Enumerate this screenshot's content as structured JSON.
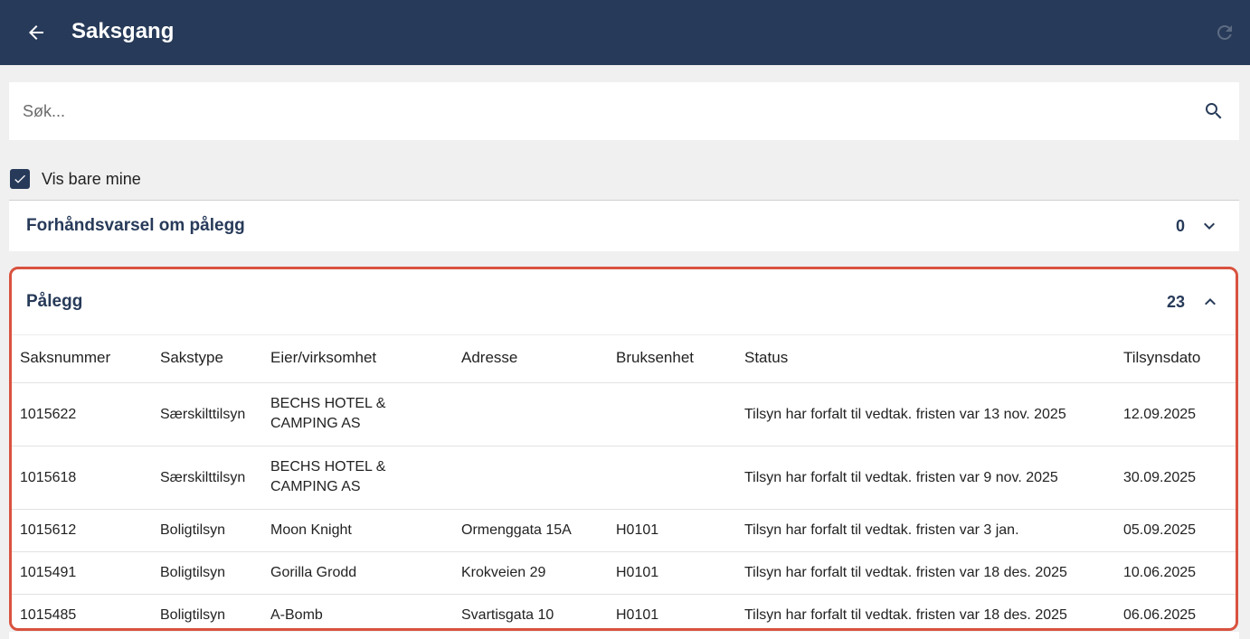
{
  "header": {
    "title": "Saksgang",
    "back_icon": "arrow-left-icon",
    "refresh_icon": "refresh-icon"
  },
  "search": {
    "placeholder": "Søk...",
    "value": "",
    "icon": "search-icon"
  },
  "filter": {
    "label": "Vis bare mine",
    "checked": true
  },
  "sections": [
    {
      "title": "Forhåndsvarsel om pålegg",
      "count": "0",
      "expanded": false
    },
    {
      "title": "Pålegg",
      "count": "23",
      "expanded": true,
      "columns": [
        "Saksnummer",
        "Sakstype",
        "Eier/virksomhet",
        "Adresse",
        "Bruksenhet",
        "Status",
        "Tilsynsdato"
      ],
      "rows": [
        {
          "saksnummer": "1015622",
          "sakstype": "Særskilttilsyn",
          "eier": "BECHS HOTEL & CAMPING AS",
          "adresse": "",
          "bruksenhet": "",
          "status": "Tilsyn har forfalt til vedtak. fristen var 13 nov. 2025",
          "dato": "12.09.2025"
        },
        {
          "saksnummer": "1015618",
          "sakstype": "Særskilttilsyn",
          "eier": "BECHS HOTEL & CAMPING AS",
          "adresse": "",
          "bruksenhet": "",
          "status": "Tilsyn har forfalt til vedtak. fristen var 9 nov. 2025",
          "dato": "30.09.2025"
        },
        {
          "saksnummer": "1015612",
          "sakstype": "Boligtilsyn",
          "eier": "Moon Knight",
          "adresse": "Ormenggata 15A",
          "bruksenhet": "H0101",
          "status": "Tilsyn har forfalt til vedtak. fristen var 3 jan.",
          "dato": "05.09.2025"
        },
        {
          "saksnummer": "1015491",
          "sakstype": "Boligtilsyn",
          "eier": "Gorilla Grodd",
          "adresse": "Krokveien 29",
          "bruksenhet": "H0101",
          "status": "Tilsyn har forfalt til vedtak. fristen var 18 des. 2025",
          "dato": "10.06.2025"
        },
        {
          "saksnummer": "1015485",
          "sakstype": "Boligtilsyn",
          "eier": "A-Bomb",
          "adresse": "Svartisgata 10",
          "bruksenhet": "H0101",
          "status": "Tilsyn har forfalt til vedtak. fristen var 18 des. 2025",
          "dato": "06.06.2025"
        }
      ]
    }
  ],
  "colors": {
    "header_bg": "#273a59",
    "accent": "#273a59",
    "highlight_border": "#d9523f",
    "page_bg": "#f0f0f0"
  }
}
